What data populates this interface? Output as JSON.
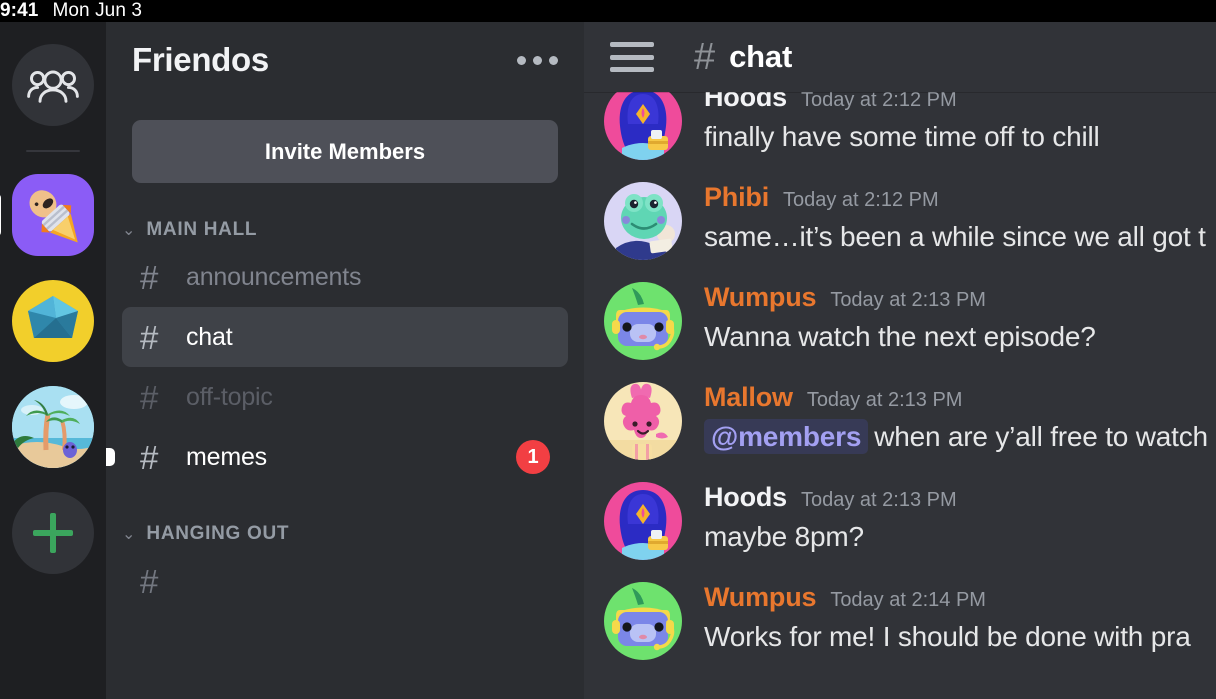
{
  "statusbar": {
    "time": "9:41",
    "date": "Mon Jun 3"
  },
  "server_rail": {
    "items": [
      {
        "name": "direct-messages",
        "icon": "people-icon",
        "label": "Direct Messages",
        "shape": "circle",
        "active": false
      },
      {
        "name": "server-rocket",
        "icon": "rocket-icon",
        "label": "Friendos",
        "shape": "square",
        "active": true
      },
      {
        "name": "server-gem",
        "icon": "gem-icon",
        "label": "Gem Server",
        "shape": "circle",
        "active": false
      },
      {
        "name": "server-island",
        "icon": "island-icon",
        "label": "Island Server",
        "shape": "circle",
        "active": false
      },
      {
        "name": "add-server",
        "icon": "plus-icon",
        "label": "Add a Server",
        "shape": "circle",
        "active": false
      }
    ]
  },
  "sidebar": {
    "server_name": "Friendos",
    "more_icon": "ellipsis-icon",
    "invite_label": "Invite Members",
    "categories": [
      {
        "label": "MAIN HALL",
        "collapse_icon": "chevron-down-icon",
        "channels": [
          {
            "name": "announcements",
            "state": "default",
            "badge": ""
          },
          {
            "name": "chat",
            "state": "active",
            "badge": ""
          },
          {
            "name": "off-topic",
            "state": "muted",
            "badge": ""
          },
          {
            "name": "memes",
            "state": "unread",
            "badge": "1"
          }
        ]
      },
      {
        "label": "HANGING OUT",
        "collapse_icon": "chevron-down-icon",
        "channels": []
      }
    ]
  },
  "chat": {
    "menu_icon": "hamburger-icon",
    "hash_icon": "hash-icon",
    "title": "chat",
    "messages": [
      {
        "author": "Hoods",
        "author_color": "white",
        "timestamp": "Today at 2:12 PM",
        "avatar": "hoods-avatar",
        "text": "finally have some time off to chill",
        "mention": ""
      },
      {
        "author": "Phibi",
        "author_color": "orange",
        "timestamp": "Today at 2:12 PM",
        "avatar": "phibi-avatar",
        "text": "same…it’s been a while since we all got t",
        "mention": ""
      },
      {
        "author": "Wumpus",
        "author_color": "orange",
        "timestamp": "Today at 2:13 PM",
        "avatar": "wumpus-avatar",
        "text": "Wanna watch the next episode?",
        "mention": ""
      },
      {
        "author": "Mallow",
        "author_color": "orange",
        "timestamp": "Today at 2:13 PM",
        "avatar": "mallow-avatar",
        "text": "when are y’all free to watch",
        "mention": "@members"
      },
      {
        "author": "Hoods",
        "author_color": "white",
        "timestamp": "Today at 2:13 PM",
        "avatar": "hoods-avatar",
        "text": "maybe 8pm?",
        "mention": ""
      },
      {
        "author": "Wumpus",
        "author_color": "orange",
        "timestamp": "Today at 2:14 PM",
        "avatar": "wumpus-avatar",
        "text": "Works for me! I should be done with pra",
        "mention": ""
      }
    ]
  },
  "colors": {
    "rail_bg": "#1e1f22",
    "sidebar_bg": "#2b2d31",
    "chat_bg": "#313338",
    "active_channel": "#3f4248",
    "invite_btn": "#4e5058",
    "badge_red": "#f23f43",
    "author_orange": "#e8772e",
    "mention_purple": "#a3a0f2",
    "add_green": "#3ba55d"
  }
}
